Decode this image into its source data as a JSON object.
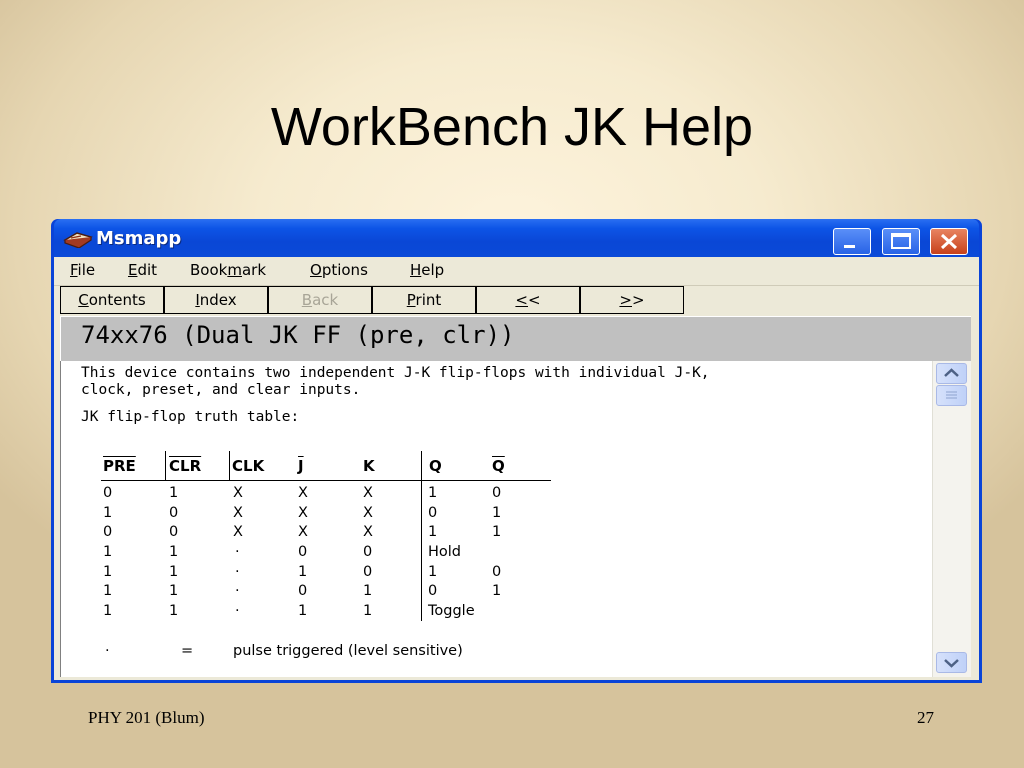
{
  "slide": {
    "title": "WorkBench JK Help",
    "footer_left": "PHY 201 (Blum)",
    "footer_right": "27"
  },
  "window": {
    "title": "Msmapp",
    "icon": "help-book-icon",
    "controls": [
      "minimize-icon",
      "maximize-icon",
      "close-icon"
    ]
  },
  "menu": [
    {
      "pre": "",
      "u": "F",
      "post": "ile"
    },
    {
      "pre": "",
      "u": "E",
      "post": "dit"
    },
    {
      "pre": "Book",
      "u": "m",
      "post": "ark"
    },
    {
      "pre": "",
      "u": "O",
      "post": "ptions"
    },
    {
      "pre": "",
      "u": "H",
      "post": "elp"
    }
  ],
  "toolbar": [
    {
      "pre": "",
      "u": "C",
      "post": "ontents",
      "enabled": true
    },
    {
      "pre": "",
      "u": "I",
      "post": "ndex",
      "enabled": true
    },
    {
      "pre": "",
      "u": "B",
      "post": "ack",
      "enabled": false
    },
    {
      "pre": "",
      "u": "P",
      "post": "rint",
      "enabled": true
    },
    {
      "pre": "",
      "u": "<",
      "post": "<",
      "enabled": true
    },
    {
      "pre": "",
      "u": ">",
      "post": ">",
      "enabled": true
    }
  ],
  "topic": {
    "heading": "74xx76 (Dual JK FF (pre, clr))",
    "description_line1": "This device contains two independent J-K flip-flops with individual J-K,",
    "description_line2": "clock, preset, and clear inputs.",
    "truth_table_title": "JK flip-flop truth table:"
  },
  "truth_table": {
    "headers": [
      "PRE",
      "CLR",
      "CLK",
      "J",
      "K",
      "Q",
      "Q"
    ],
    "overlined": [
      true,
      true,
      false,
      true,
      false,
      false,
      true
    ],
    "rows": [
      [
        "0",
        "1",
        "X",
        "X",
        "X",
        "1",
        "0"
      ],
      [
        "1",
        "0",
        "X",
        "X",
        "X",
        "0",
        "1"
      ],
      [
        "0",
        "0",
        "X",
        "X",
        "X",
        "1",
        "1"
      ],
      [
        "1",
        "1",
        "·",
        "0",
        "0",
        "Hold",
        ""
      ],
      [
        "1",
        "1",
        "·",
        "1",
        "0",
        "1",
        "0"
      ],
      [
        "1",
        "1",
        "·",
        "0",
        "1",
        "0",
        "1"
      ],
      [
        "1",
        "1",
        "·",
        "1",
        "1",
        "Toggle",
        ""
      ]
    ]
  },
  "footnote": {
    "symbol": "·",
    "equals": "=",
    "text": "pulse triggered (level sensitive)"
  },
  "scrollbar": {
    "up_icon": "chevron-up-icon",
    "thumb_icon": "scroll-thumb-grip-icon",
    "down_icon": "chevron-down-icon"
  }
}
